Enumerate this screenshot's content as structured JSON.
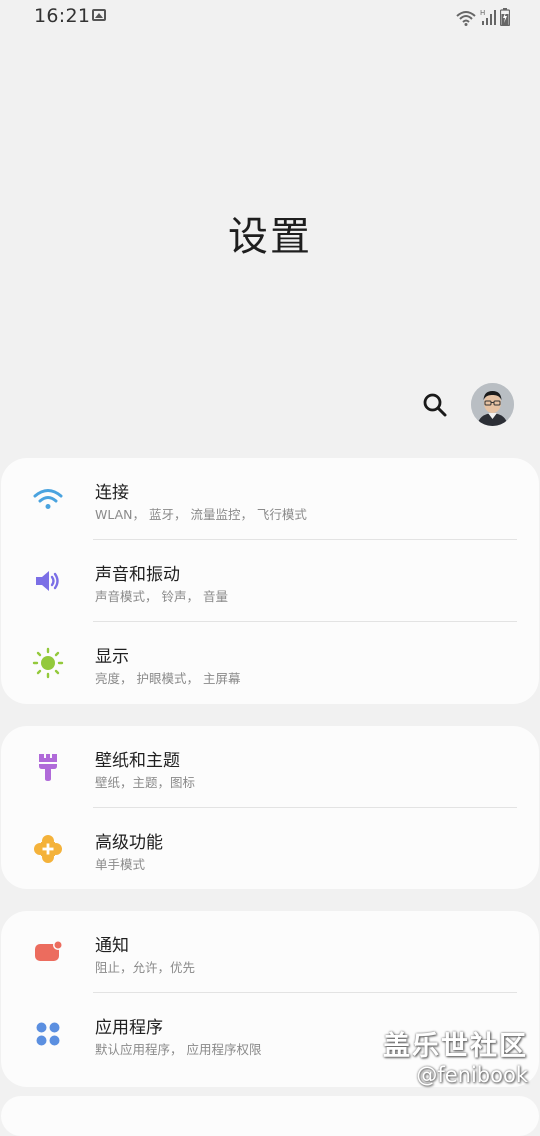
{
  "status_bar": {
    "time": "16:21"
  },
  "header": {
    "title": "设置"
  },
  "cards": [
    {
      "items": [
        {
          "title": "连接",
          "subtitle": "WLAN， 蓝牙， 流量监控， 飞行模式",
          "icon": "wifi-icon",
          "color": "#4aa3df"
        },
        {
          "title": "声音和振动",
          "subtitle": "声音模式， 铃声， 音量",
          "icon": "speaker-icon",
          "color": "#7b6fe6"
        },
        {
          "title": "显示",
          "subtitle": "亮度， 护眼模式， 主屏幕",
          "icon": "brightness-icon",
          "color": "#93c93b"
        }
      ]
    },
    {
      "items": [
        {
          "title": "壁纸和主题",
          "subtitle": "壁纸，主题，图标",
          "icon": "paintbrush-icon",
          "color": "#b06ad9"
        },
        {
          "title": "高级功能",
          "subtitle": "单手模式",
          "icon": "puzzle-plus-icon",
          "color": "#f4b23a"
        }
      ]
    },
    {
      "items": [
        {
          "title": "通知",
          "subtitle": "阻止，允许，优先",
          "icon": "notification-icon",
          "color": "#ec6c5e"
        },
        {
          "title": "应用程序",
          "subtitle": "默认应用程序， 应用程序权限",
          "icon": "apps-grid-icon",
          "color": "#5b8fe0"
        }
      ]
    }
  ],
  "watermark": {
    "line1": "盖乐世社区",
    "line2": "@fenibook"
  }
}
